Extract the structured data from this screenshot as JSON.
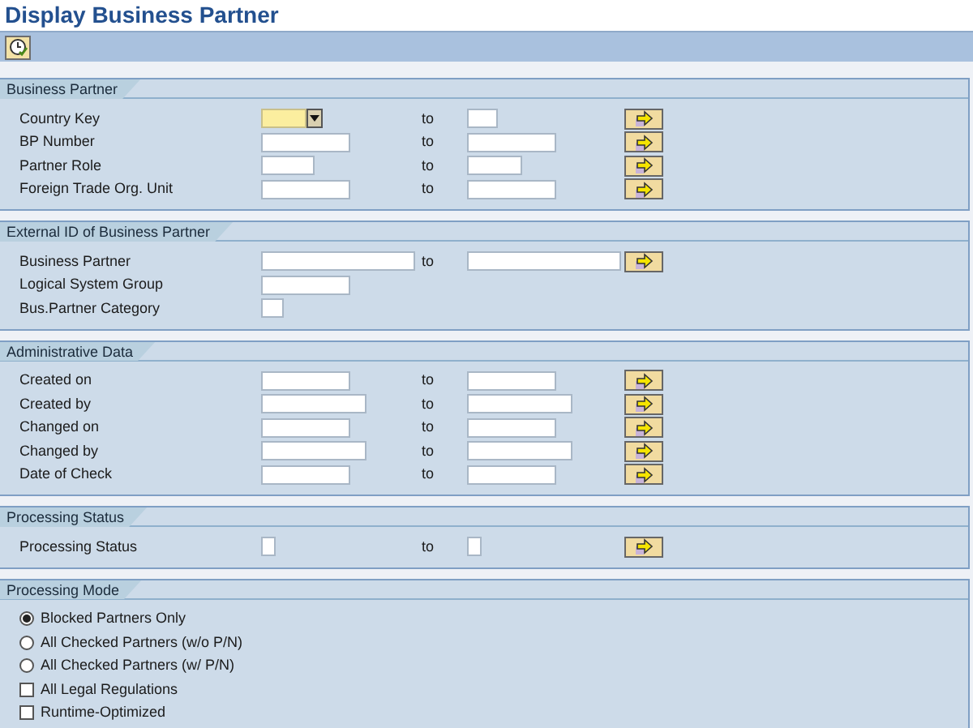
{
  "title": "Display Business Partner",
  "sections": [
    {
      "kind": "fields",
      "title": "Business Partner",
      "rows": [
        {
          "kind": "dropdown-range",
          "label": "Country Key",
          "to_label": "to"
        },
        {
          "kind": "range",
          "label": "BP Number",
          "to_label": "to"
        },
        {
          "kind": "range",
          "label": "Partner Role",
          "to_label": "to"
        },
        {
          "kind": "range",
          "label": "Foreign Trade Org. Unit",
          "to_label": "to"
        }
      ]
    },
    {
      "kind": "fields",
      "title": "External ID of Business Partner",
      "rows": [
        {
          "kind": "range",
          "label": "Business Partner",
          "to_label": "to"
        },
        {
          "kind": "single",
          "label": "Logical System Group"
        },
        {
          "kind": "single",
          "label": "Bus.Partner Category"
        }
      ]
    },
    {
      "kind": "fields",
      "title": "Administrative Data",
      "rows": [
        {
          "kind": "range",
          "label": "Created on",
          "to_label": "to"
        },
        {
          "kind": "range",
          "label": "Created by",
          "to_label": "to"
        },
        {
          "kind": "range",
          "label": "Changed on",
          "to_label": "to"
        },
        {
          "kind": "range",
          "label": "Changed by",
          "to_label": "to"
        },
        {
          "kind": "range",
          "label": "Date of Check",
          "to_label": "to"
        }
      ]
    },
    {
      "kind": "fields",
      "title": "Processing Status",
      "rows": [
        {
          "kind": "range",
          "label": "Processing Status",
          "to_label": "to"
        }
      ]
    },
    {
      "kind": "options",
      "title": "Processing Mode",
      "options": [
        {
          "kind": "radio",
          "label": "Blocked Partners Only",
          "selected": true
        },
        {
          "kind": "radio",
          "label": "All Checked Partners (w/o P/N)",
          "selected": false
        },
        {
          "kind": "radio",
          "label": "All Checked Partners (w/ P/N)",
          "selected": false
        },
        {
          "kind": "checkbox",
          "label": "All Legal Regulations",
          "checked": false
        },
        {
          "kind": "checkbox",
          "label": "Runtime-Optimized",
          "checked": false
        }
      ]
    }
  ]
}
